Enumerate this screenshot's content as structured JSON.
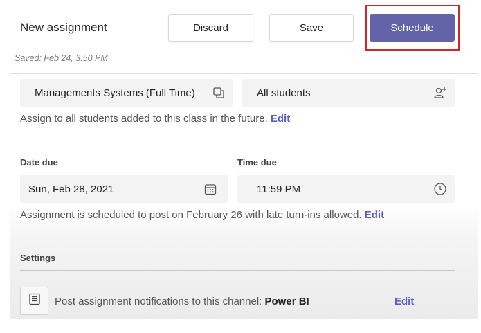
{
  "header": {
    "title": "New assignment",
    "saved_status": "Saved: Feb 24, 3:50 PM",
    "discard_label": "Discard",
    "save_label": "Save",
    "schedule_label": "Schedule"
  },
  "assign": {
    "class_name": "Managements Systems (Full Time)",
    "students": "All students",
    "help_text": "Assign to all students added to this class in the future.",
    "edit_label": "Edit"
  },
  "due": {
    "date_label": "Date due",
    "date_value": "Sun, Feb 28, 2021",
    "time_label": "Time due",
    "time_value": "11:59 PM",
    "schedule_text": "Assignment is scheduled to post on February 26 with late turn-ins allowed.",
    "edit_label": "Edit"
  },
  "settings": {
    "heading": "Settings",
    "notification_text": "Post assignment notifications to this channel:",
    "channel_name": "Power BI",
    "edit_label": "Edit"
  },
  "icons": {
    "class": "copy-icon",
    "students": "add-person-icon",
    "date": "calendar-icon",
    "time": "clock-icon",
    "channel": "document-list-icon"
  },
  "colors": {
    "accent": "#6264a7",
    "link": "#5b5fc7",
    "highlight": "#d1272a"
  }
}
